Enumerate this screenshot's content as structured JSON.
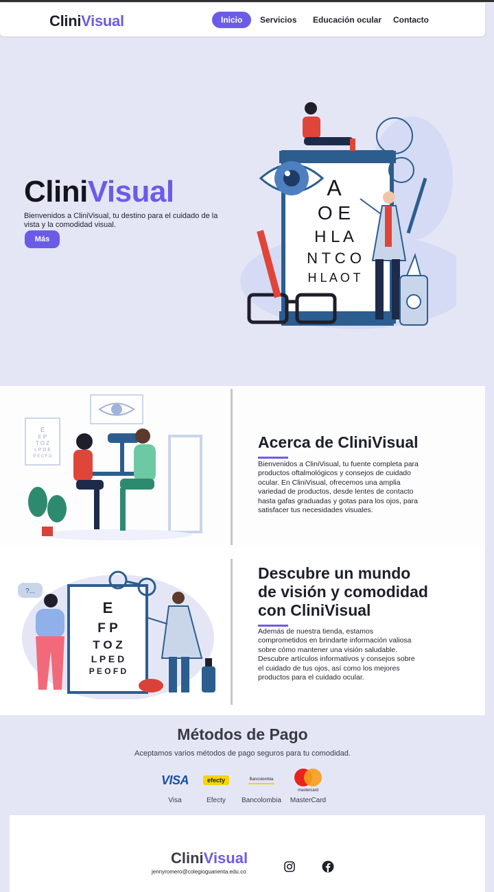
{
  "brand": {
    "part1": "Clini",
    "part2": "Visual"
  },
  "nav": {
    "items": [
      {
        "label": "Inicio",
        "active": true
      },
      {
        "label": "Servicios"
      },
      {
        "label": "Educación ocular"
      },
      {
        "label": "Contacto"
      }
    ]
  },
  "hero": {
    "title_part1": "Clini",
    "title_part2": "Visual",
    "subtitle": "Bienvenidos a CliniVisual, tu destino para el cuidado de la vista y la comodidad visual.",
    "button": "Más",
    "chart_letters": [
      "A",
      "O E",
      "H L A",
      "N T C O",
      "H L A O T"
    ]
  },
  "about": {
    "title": "Acerca de CliniVisual",
    "text": "Bienvenidos a CliniVisual, tu fuente completa para productos oftalmológicos y consejos de cuidado ocular. En CliniVisual, ofrecemos una amplia variedad de productos, desde lentes de contacto hasta gafas graduadas y gotas para los ojos, para satisfacer tus necesidades visuales.",
    "chart_letters": [
      "E",
      "F P",
      "T O Z",
      "L P D E",
      "P E C F D"
    ]
  },
  "discover": {
    "title": "Descubre un mundo de visión y comodidad con CliniVisual",
    "text": "Además de nuestra tienda, estamos comprometidos en brindarte información valiosa sobre cómo mantener una visión saludable. Descubre artículos informativos y consejos sobre el cuidado de tus ojos, así como los mejores productos para el cuidado ocular.",
    "bubble": "?...",
    "chart_letters": [
      "E",
      "F P",
      "T O Z",
      "L P E D",
      "P E O F D"
    ]
  },
  "payments": {
    "title": "Métodos de Pago",
    "subtitle": "Aceptamos varios métodos de pago seguros para tu comodidad.",
    "methods": [
      {
        "name": "Visa",
        "logo_text": "VISA"
      },
      {
        "name": "Efecty",
        "logo_text": "efecty"
      },
      {
        "name": "Bancolombia",
        "logo_text": "Bancolombia"
      },
      {
        "name": "MasterCard",
        "logo_text": "mastercard"
      }
    ]
  },
  "footer": {
    "brand_part1": "Clini",
    "brand_part2": "Visual",
    "email": "jennyromero@colegioguanenta.edu.co"
  },
  "colors": {
    "accent": "#6b5ce7",
    "background": "#e4e6f6",
    "dark": "#1f1f2b"
  }
}
